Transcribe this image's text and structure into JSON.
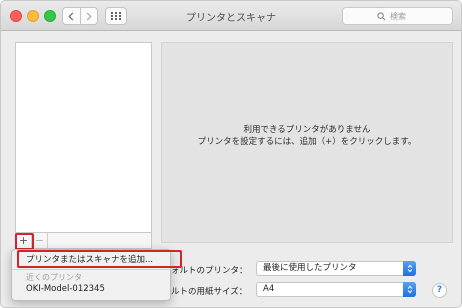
{
  "window": {
    "title": "プリンタとスキャナ"
  },
  "toolbar": {
    "search_placeholder": "検索",
    "back_icon": "chevron-left-icon",
    "forward_icon": "chevron-right-icon",
    "grid_icon": "grid-icon"
  },
  "printer_list": {
    "add_label": "+",
    "remove_label": "−"
  },
  "detail": {
    "empty_line1": "利用できるプリンタがありません",
    "empty_line2": "プリンタを設定するには、追加（+）をクリックします。"
  },
  "settings": {
    "default_printer_label": "ォルトのプリンタ：",
    "default_printer_value": "最後に使用したプリンタ",
    "paper_size_label": "ルトの用紙サイズ：",
    "paper_size_value": "A4"
  },
  "add_menu": {
    "add_item": "プリンタまたはスキャナを追加...",
    "nearby_header": "近くのプリンタ",
    "nearby_device": "OKI-Model-012345"
  },
  "help": {
    "label": "?"
  },
  "colors": {
    "highlight_red": "#d1242b",
    "accent_blue": "#1f6fe0"
  }
}
